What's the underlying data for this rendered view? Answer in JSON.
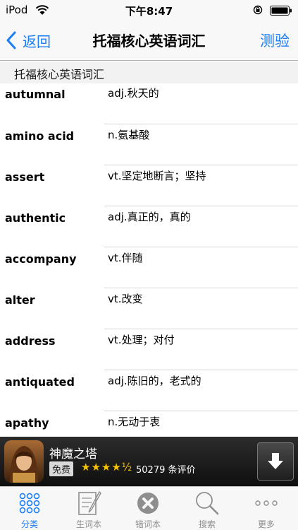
{
  "status_bar": {
    "carrier": "iPod",
    "time": "下午8:47"
  },
  "nav": {
    "back_label": "返回",
    "title": "托福核心英语词汇",
    "right_label": "测验"
  },
  "section": {
    "title": "托福核心英语词汇"
  },
  "words": [
    {
      "term": "autumnal",
      "definition": "adj.秋天的"
    },
    {
      "term": "amino acid",
      "definition": "n.氨基酸"
    },
    {
      "term": "assert",
      "definition": "vt.坚定地断言；坚持"
    },
    {
      "term": "authentic",
      "definition": "adj.真正的，真的"
    },
    {
      "term": "accompany",
      "definition": "vt.伴随"
    },
    {
      "term": "alter",
      "definition": "vt.改变"
    },
    {
      "term": "address",
      "definition": "vt.处理；对付"
    },
    {
      "term": "antiquated",
      "definition": "adj.陈旧的，老式的"
    },
    {
      "term": "apathy",
      "definition": "n.无动于衷"
    }
  ],
  "ad": {
    "title": "神魔之塔",
    "price": "免费",
    "rating": 4.5,
    "stars": "★★★★½",
    "reviews": "50279 条评价"
  },
  "tabs": [
    {
      "label": "分类",
      "icon": "grid-dots-icon",
      "active": true
    },
    {
      "label": "生词本",
      "icon": "notebook-pencil-icon",
      "active": false
    },
    {
      "label": "错词本",
      "icon": "x-circle-icon",
      "active": false
    },
    {
      "label": "搜索",
      "icon": "magnifier-icon",
      "active": false
    },
    {
      "label": "更多",
      "icon": "more-dots-icon",
      "active": false
    }
  ],
  "colors": {
    "accent": "#1a7ef7",
    "tab_inactive": "#8e8e8e",
    "star": "#f5c400"
  }
}
